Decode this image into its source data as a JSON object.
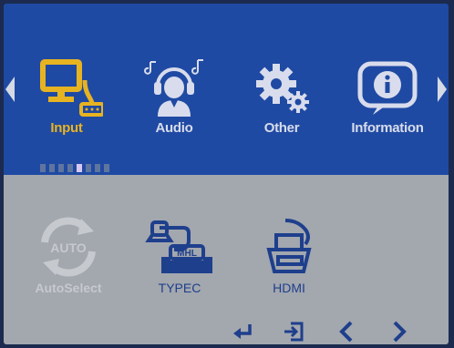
{
  "colors": {
    "panel_top": "#1f4aa3",
    "panel_bottom": "#a3a7ae",
    "active_accent": "#e7b321",
    "icon_light": "#d8dcec",
    "source_icon": "#1e3f8c",
    "disabled": "#c6c9ce"
  },
  "categories": [
    {
      "label": "Input",
      "icon": "monitor-vga-icon",
      "active": true
    },
    {
      "label": "Audio",
      "icon": "headset-user-icon",
      "active": false
    },
    {
      "label": "Other",
      "icon": "gears-icon",
      "active": false
    },
    {
      "label": "Information",
      "icon": "info-icon",
      "active": false
    }
  ],
  "page_indicator": {
    "count": 8,
    "active_index": 4
  },
  "sources": [
    {
      "label": "AutoSelect",
      "icon": "auto-cycle-icon",
      "icon_text": "AUTO",
      "enabled": false
    },
    {
      "label": "TYPEC",
      "icon": "typec-mhl-cable-icon",
      "icon_text": "MHL",
      "enabled": true
    },
    {
      "label": "HDMI",
      "icon": "hdmi-cable-icon",
      "enabled": true
    }
  ],
  "nav_buttons": [
    "enter-icon",
    "exit-icon",
    "left-icon",
    "right-icon"
  ]
}
